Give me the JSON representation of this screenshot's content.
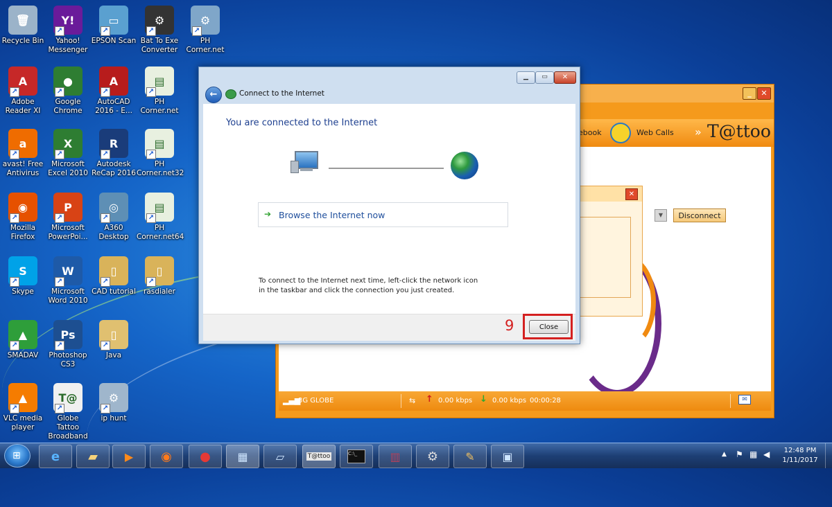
{
  "desktop": {
    "icons": [
      {
        "label": "Recycle Bin",
        "glyph": "🗑",
        "color": "#9bb3c9"
      },
      {
        "label": "Yahoo! Messenger",
        "glyph": "Y!",
        "color": "#6a1b9a"
      },
      {
        "label": "EPSON Scan",
        "glyph": "▭",
        "color": "#5aa0d0"
      },
      {
        "label": "Bat To Exe Converter",
        "glyph": "⚙",
        "color": "#333333"
      },
      {
        "label": "PH Corner.net",
        "glyph": "⚙",
        "color": "#7fa6c9"
      },
      {
        "label": "Adobe Reader XI",
        "glyph": "A",
        "color": "#c62828"
      },
      {
        "label": "Google Chrome",
        "glyph": "●",
        "color": "#2e7d32"
      },
      {
        "label": "AutoCAD 2016 - E...",
        "glyph": "A",
        "color": "#b71c1c"
      },
      {
        "label": "PH Corner.net",
        "glyph": "▤",
        "color": "#e8f0e0"
      },
      {
        "label": "avast! Free Antivirus",
        "glyph": "a",
        "color": "#ef6c00"
      },
      {
        "label": "Microsoft Excel 2010",
        "glyph": "X",
        "color": "#2e7d32"
      },
      {
        "label": "Autodesk ReCap 2016",
        "glyph": "R",
        "color": "#1a3c7a"
      },
      {
        "label": "PH Corner.net32",
        "glyph": "▤",
        "color": "#e8f0e0"
      },
      {
        "label": "Mozilla Firefox",
        "glyph": "◉",
        "color": "#e65100"
      },
      {
        "label": "Microsoft PowerPoi...",
        "glyph": "P",
        "color": "#d84315"
      },
      {
        "label": "A360 Desktop",
        "glyph": "◎",
        "color": "#5e8fb5"
      },
      {
        "label": "PH Corner.net64",
        "glyph": "▤",
        "color": "#e8f0e0"
      },
      {
        "label": "Skype",
        "glyph": "S",
        "color": "#00a2e8"
      },
      {
        "label": "Microsoft Word 2010",
        "glyph": "W",
        "color": "#1e5aa8"
      },
      {
        "label": "CAD tutorial",
        "glyph": "▯",
        "color": "#d9b35a"
      },
      {
        "label": "rasdialer",
        "glyph": "▯",
        "color": "#d9b35a"
      },
      {
        "label": "SMADAV",
        "glyph": "▲",
        "color": "#2e9e3a"
      },
      {
        "label": "Photoshop CS3",
        "glyph": "Ps",
        "color": "#1d4f91"
      },
      {
        "label": "Java",
        "glyph": "▯",
        "color": "#e0c070"
      },
      {
        "label": "VLC media player",
        "glyph": "▲",
        "color": "#f57c00"
      },
      {
        "label": "Globe Tattoo Broadband",
        "glyph": "T@",
        "color": "#f0f0f0"
      },
      {
        "label": "ip hunt",
        "glyph": "⚙",
        "color": "#9fb6cc"
      }
    ]
  },
  "tattoo": {
    "nav_facebook": "ebook",
    "nav_webcalls": "Web Calls",
    "brand": "T@ttoo",
    "brand_prefix": "»",
    "disconnect": "Disconnect",
    "status_network": "3G  GLOBE",
    "upload": "0.00 kbps",
    "download": "0.00 kbps",
    "timer": "00:00:28"
  },
  "dialog": {
    "title": "Connect to the Internet",
    "heading": "You are connected to the Internet",
    "browse": "Browse the Internet now",
    "hint": "To connect to the Internet next time, left-click the network icon in the taskbar and click the connection you just created.",
    "close": "Close",
    "step": "9",
    "step_color": "#d42020"
  },
  "taskbar": {
    "time": "12:48 PM",
    "date": "1/11/2017",
    "tattoo_label": "T@ttoo"
  }
}
